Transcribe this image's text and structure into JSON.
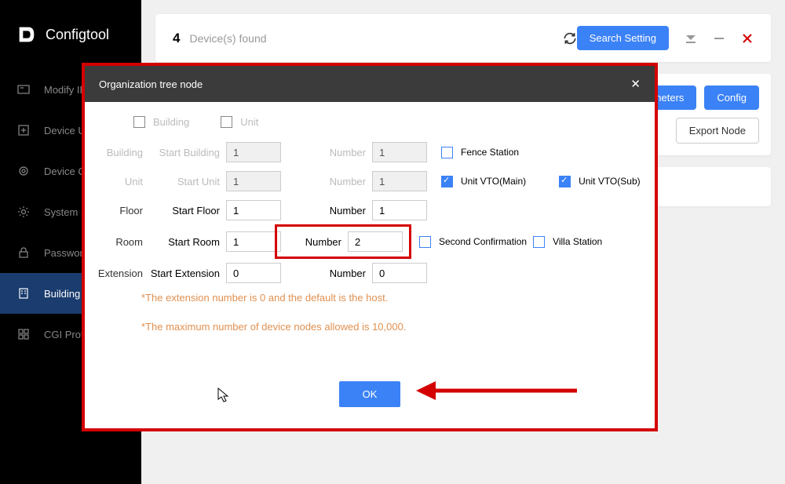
{
  "brand": "Configtool",
  "topbar": {
    "count": "4",
    "found": "Device(s) found",
    "search_setting": "Search Setting"
  },
  "nav": [
    {
      "label": "Modify IP"
    },
    {
      "label": "Device Upgrade"
    },
    {
      "label": "Device Config"
    },
    {
      "label": "System Settings"
    },
    {
      "label": "Password Reset"
    },
    {
      "label": "Building Config"
    },
    {
      "label": "CGI Protocol"
    }
  ],
  "content_actions": {
    "parameters": "Parameters",
    "config": "Config",
    "export_node": "Export Node"
  },
  "modal": {
    "title": "Organization tree node",
    "building_hdr": "Building",
    "unit_hdr": "Unit",
    "rows": {
      "building": {
        "cat": "Building",
        "start_label": "Start Building",
        "start_val": "1",
        "num_label": "Number",
        "num_val": "1"
      },
      "unit": {
        "cat": "Unit",
        "start_label": "Start Unit",
        "start_val": "1",
        "num_label": "Number",
        "num_val": "1"
      },
      "floor": {
        "cat": "Floor",
        "start_label": "Start Floor",
        "start_val": "1",
        "num_label": "Number",
        "num_val": "1"
      },
      "room": {
        "cat": "Room",
        "start_label": "Start Room",
        "start_val": "1",
        "num_label": "Number",
        "num_val": "2"
      },
      "extension": {
        "cat": "Extension",
        "start_label": "Start Extension",
        "start_val": "0",
        "num_label": "Number",
        "num_val": "0"
      }
    },
    "checks": {
      "fence": "Fence Station",
      "vto_main": "Unit VTO(Main)",
      "vto_sub": "Unit VTO(Sub)",
      "second_conf": "Second Confirmation",
      "villa": "Villa Station"
    },
    "hint1": "*The extension number is 0 and the default is the host.",
    "hint2": "*The maximum number of device nodes allowed is 10,000.",
    "ok": "OK"
  }
}
